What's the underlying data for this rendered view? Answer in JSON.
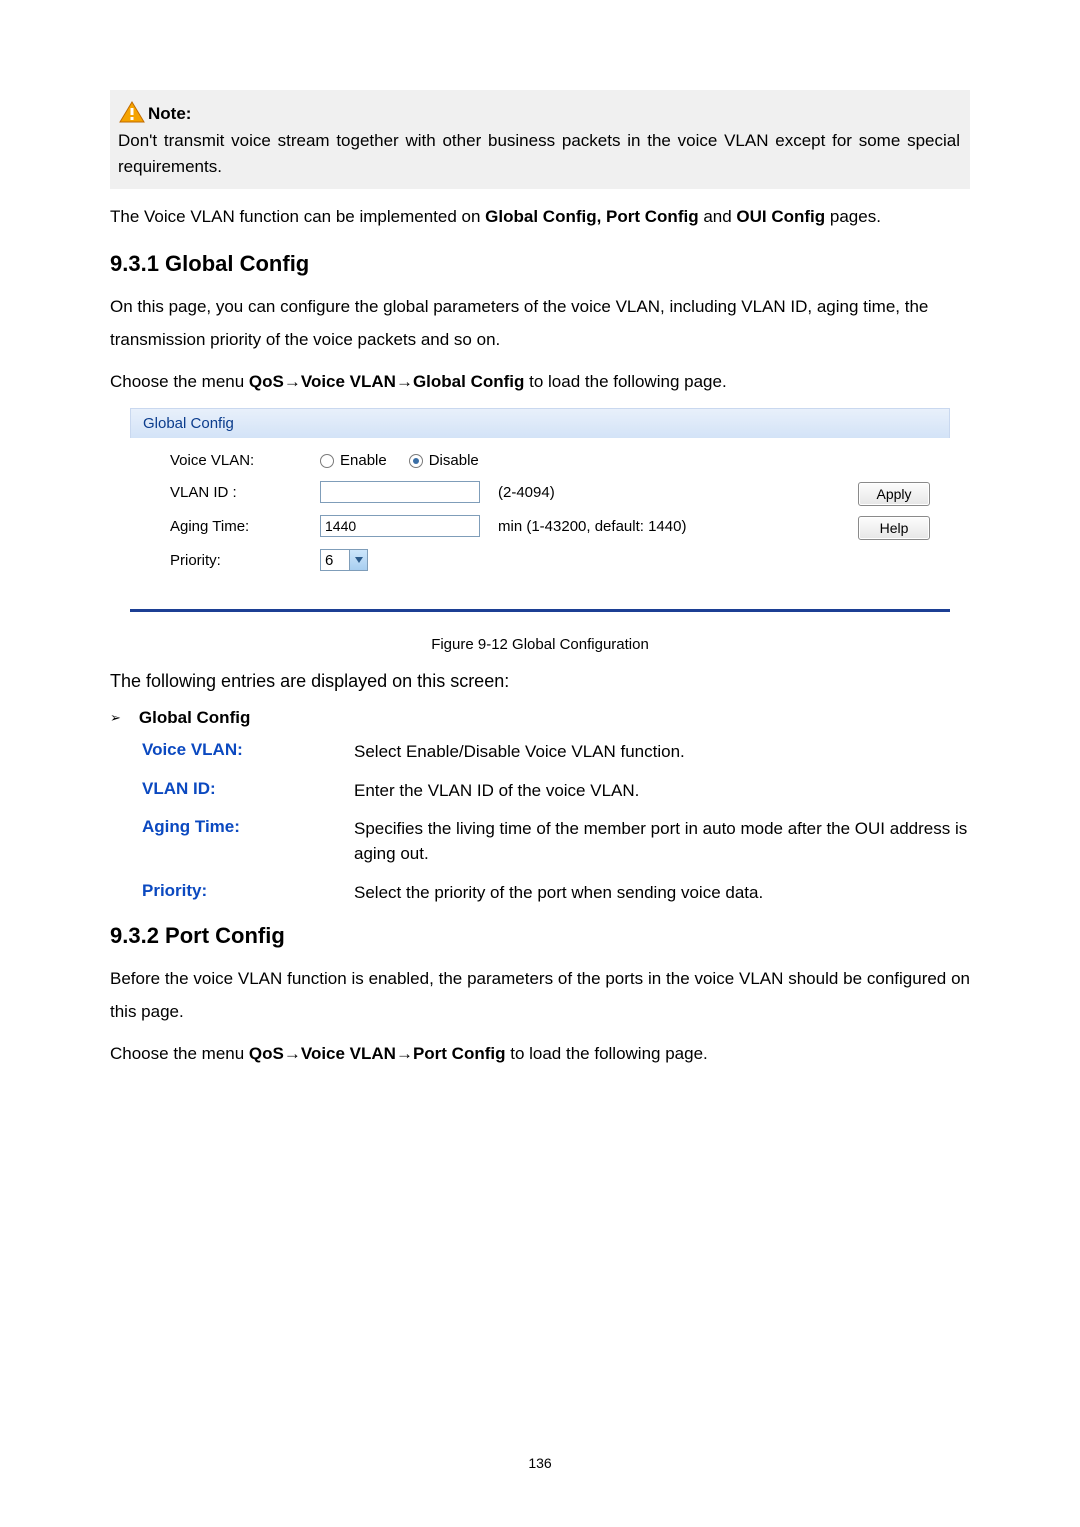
{
  "note": {
    "label": "Note:",
    "text": "Don't transmit voice stream together with other business packets in the voice VLAN except for some special requirements."
  },
  "intro_para_prefix": "The Voice VLAN function can be implemented on ",
  "intro_para_bold": "Global Config, Port Config",
  "intro_para_mid": " and ",
  "intro_para_bold2": "OUI Config",
  "intro_para_suffix": " pages.",
  "section931_heading": "9.3.1 Global Config",
  "section931_para": "On this page, you can configure the global parameters of the voice VLAN, including VLAN ID, aging time, the transmission priority of the voice packets and so on.",
  "menu_prefix": "Choose the menu ",
  "menu_path1": "QoS→Voice VLAN→Global Config",
  "menu_suffix": " to load the following page.",
  "panel": {
    "title": "Global Config",
    "voice_vlan_label": "Voice VLAN:",
    "enable": "Enable",
    "disable": "Disable",
    "vlan_id_label": "VLAN ID :",
    "vlan_id_hint": "(2-4094)",
    "aging_label": "Aging Time:",
    "aging_value": "1440",
    "aging_hint": "min (1-43200, default: 1440)",
    "priority_label": "Priority:",
    "priority_value": "6",
    "apply_btn": "Apply",
    "help_btn": "Help"
  },
  "figure_caption": "Figure 9-12 Global Configuration",
  "entries_intro": "The following entries are displayed on this screen:",
  "bullet_label": "Global Config",
  "defs": [
    {
      "term": "Voice VLAN:",
      "desc": "Select Enable/Disable Voice VLAN function."
    },
    {
      "term": "VLAN ID:",
      "desc": "Enter the VLAN ID of the voice VLAN."
    },
    {
      "term": "Aging Time:",
      "desc": "Specifies the living time of the member port in auto mode after the OUI address is aging out."
    },
    {
      "term": "Priority:",
      "desc": "Select the priority of the port when sending voice data."
    }
  ],
  "section932_heading": "9.3.2 Port Config",
  "section932_para": "Before the voice VLAN function is enabled, the parameters of the ports in the voice VLAN should be configured on this page.",
  "menu_path2": "QoS→Voice VLAN→Port Config",
  "page_number": "136"
}
